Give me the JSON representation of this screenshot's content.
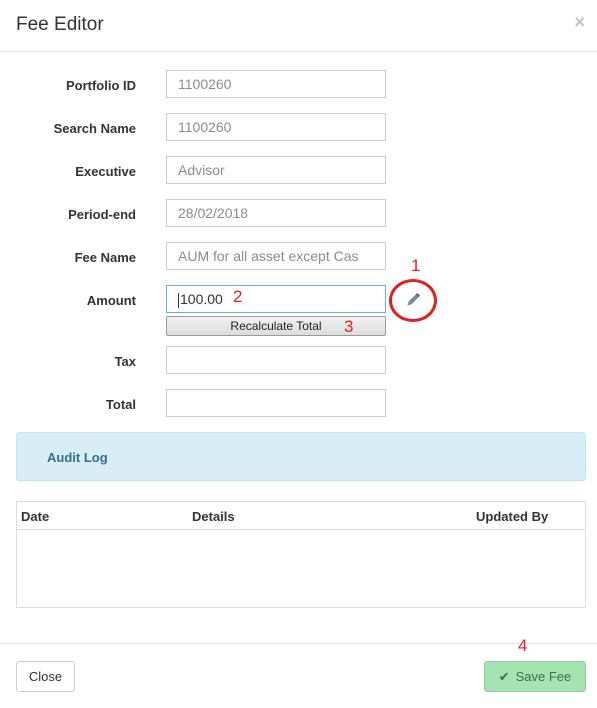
{
  "modal": {
    "title": "Fee Editor",
    "close_glyph": "×"
  },
  "form": {
    "fields": [
      {
        "key": "portfolio_id",
        "label": "Portfolio ID",
        "value": "1100260"
      },
      {
        "key": "search_name",
        "label": "Search Name",
        "value": "1100260"
      },
      {
        "key": "executive",
        "label": "Executive",
        "value": "Advisor"
      },
      {
        "key": "period_end",
        "label": "Period-end",
        "value": "28/02/2018"
      },
      {
        "key": "fee_name",
        "label": "Fee Name",
        "value": "AUM for all asset except Cas"
      },
      {
        "key": "amount",
        "label": "Amount",
        "value": "100.00"
      },
      {
        "key": "tax",
        "label": "Tax",
        "value": ""
      },
      {
        "key": "total",
        "label": "Total",
        "value": ""
      }
    ],
    "recalculate_label": "Recalculate Total",
    "edit_icon": "pencil-icon"
  },
  "annotations": {
    "n1": "1",
    "n2": "2",
    "n3": "3",
    "n4": "4",
    "color": "#e02020"
  },
  "audit": {
    "title": "Audit Log",
    "columns": [
      "Date",
      "Details",
      "Updated By"
    ]
  },
  "footer": {
    "close_label": "Close",
    "save_label": "Save Fee",
    "save_icon": "check-icon"
  },
  "colors": {
    "info_bg": "#d9edf7",
    "info_text": "#31708f",
    "success_bg": "#a6e3b3",
    "success_text": "#2f7a3a"
  }
}
